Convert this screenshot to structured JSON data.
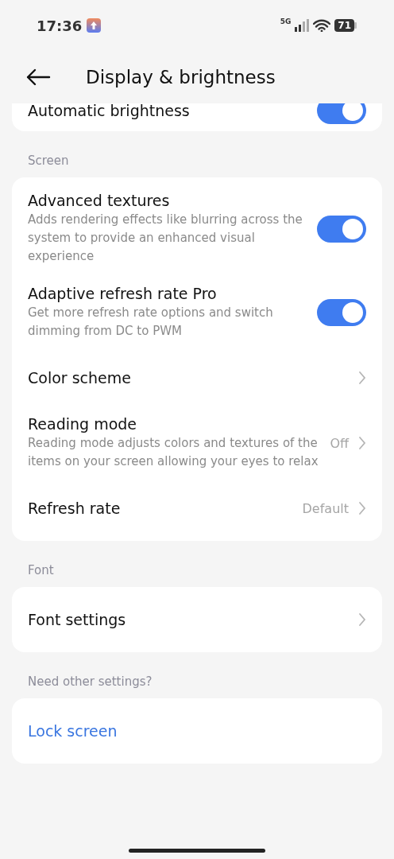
{
  "status_bar": {
    "time": "17:36",
    "network": "5G",
    "battery": "71"
  },
  "header": {
    "title": "Display & brightness"
  },
  "top_card": {
    "rows": [
      {
        "kind": "toggle",
        "title": "Automatic brightness",
        "on": true
      }
    ]
  },
  "sections": [
    {
      "label": "Screen",
      "rows": [
        {
          "kind": "toggle",
          "title": "Advanced textures",
          "subtitle": "Adds rendering effects like blurring across the system to provide an enhanced visual experience",
          "on": true
        },
        {
          "kind": "toggle",
          "title": "Adaptive refresh rate Pro",
          "subtitle": "Get more refresh rate options and switch dimming from DC to PWM",
          "on": true
        },
        {
          "kind": "link",
          "title": "Color scheme"
        },
        {
          "kind": "link",
          "title": "Reading mode",
          "subtitle": "Reading mode adjusts colors and textures of the items on your screen allowing your eyes to relax",
          "value": "Off"
        },
        {
          "kind": "link",
          "title": "Refresh rate",
          "value": "Default"
        }
      ]
    },
    {
      "label": "Font",
      "rows": [
        {
          "kind": "link",
          "title": "Font settings"
        }
      ]
    },
    {
      "label": "Need other settings?",
      "rows": [
        {
          "kind": "action",
          "title": "Lock screen"
        }
      ]
    }
  ]
}
